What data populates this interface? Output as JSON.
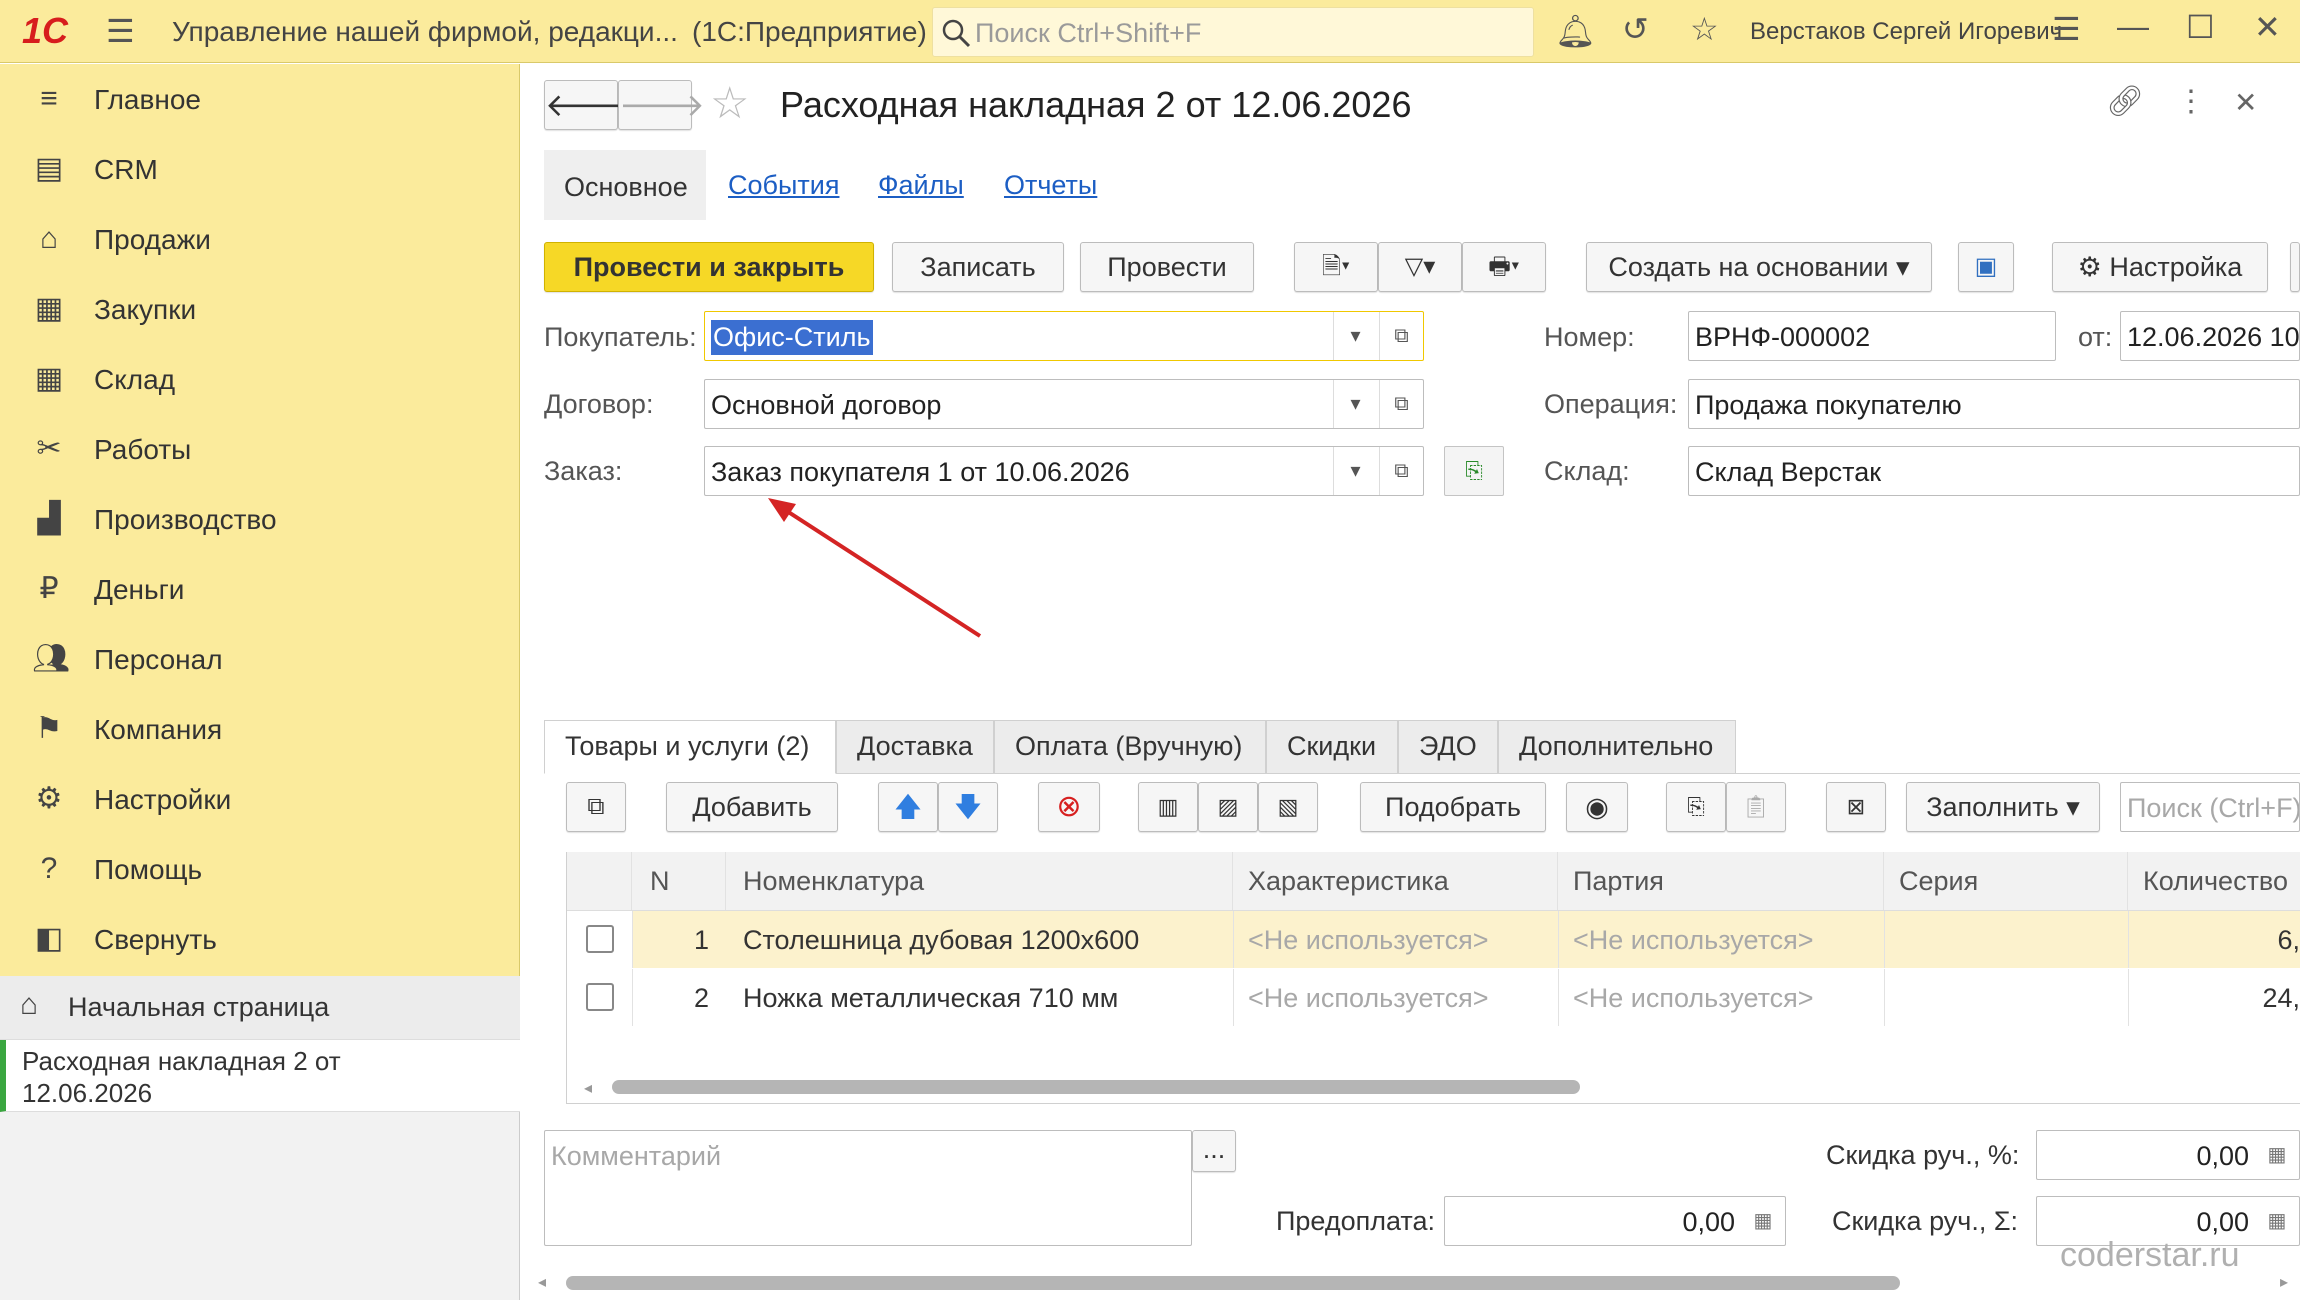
{
  "topbar": {
    "logo": "1С",
    "app_title": "Управление нашей фирмой, редакци...",
    "platform": "(1С:Предприятие)",
    "search_placeholder": "Поиск Ctrl+Shift+F",
    "user": "Верстаков Сергей Игоревич"
  },
  "sidebar": {
    "items": [
      {
        "label": "Главное",
        "icon": "menu-lines-icon"
      },
      {
        "label": "CRM",
        "icon": "contacts-card-icon"
      },
      {
        "label": "Продажи",
        "icon": "shop-basket-icon"
      },
      {
        "label": "Закупки",
        "icon": "cart-icon"
      },
      {
        "label": "Склад",
        "icon": "warehouse-grid-icon"
      },
      {
        "label": "Работы",
        "icon": "tools-icon"
      },
      {
        "label": "Производство",
        "icon": "factory-icon"
      },
      {
        "label": "Деньги",
        "icon": "ruble-coin-icon"
      },
      {
        "label": "Персонал",
        "icon": "people-icon"
      },
      {
        "label": "Компания",
        "icon": "flag-icon"
      },
      {
        "label": "Настройки",
        "icon": "gear-icon"
      },
      {
        "label": "Помощь",
        "icon": "question-icon"
      },
      {
        "label": "Свернуть",
        "icon": "collapse-panel-icon"
      }
    ],
    "home_label": "Начальная страница",
    "open_doc_line1": "Расходная накладная 2 от",
    "open_doc_line2": "12.06.2026"
  },
  "document": {
    "title": "Расходная накладная 2 от 12.06.2026",
    "tabs": [
      "Основное",
      "События",
      "Файлы",
      "Отчеты"
    ],
    "toolbar": {
      "post_close": "Провести и закрыть",
      "save": "Записать",
      "post": "Провести",
      "create_based": "Создать на основании",
      "settings": "Настройка"
    },
    "fields": {
      "buyer_label": "Покупатель:",
      "buyer_value": "Офис-Стиль",
      "contract_label": "Договор:",
      "contract_value": "Основной договор",
      "order_label": "Заказ:",
      "order_value": "Заказ покупателя 1 от 10.06.2026",
      "number_label": "Номер:",
      "number_value": "ВРНФ-000002",
      "date_label": "от:",
      "date_value": "12.06.2026 10",
      "operation_label": "Операция:",
      "operation_value": "Продажа покупателю",
      "warehouse_label": "Склад:",
      "warehouse_value": "Склад Верстак"
    },
    "lower_tabs": [
      "Товары и услуги (2)",
      "Доставка",
      "Оплата (Вручную)",
      "Скидки",
      "ЭДО",
      "Дополнительно"
    ],
    "table_toolbar": {
      "add": "Добавить",
      "pick": "Подобрать",
      "fill": "Заполнить",
      "search_placeholder": "Поиск (Ctrl+F)"
    },
    "table": {
      "columns": [
        "N",
        "Номенклатура",
        "Характеристика",
        "Партия",
        "Серия",
        "Количество"
      ],
      "rows": [
        {
          "n": "1",
          "name": "Столешница дубовая 1200х600",
          "char": "<Не используется>",
          "batch": "<Не используется>",
          "series": "",
          "qty": "6,"
        },
        {
          "n": "2",
          "name": "Ножка металлическая 710 мм",
          "char": "<Не используется>",
          "batch": "<Не используется>",
          "series": "",
          "qty": "24,"
        }
      ]
    },
    "footer": {
      "comment_placeholder": "Комментарий",
      "comment_btn": "...",
      "prepay_label": "Предоплата:",
      "prepay_value": "0,00",
      "discount_pct_label": "Скидка руч., %:",
      "discount_pct_value": "0,00",
      "discount_sum_label": "Скидка руч., Σ:",
      "discount_sum_value": "0,00"
    },
    "watermark": "coderstar.ru"
  }
}
